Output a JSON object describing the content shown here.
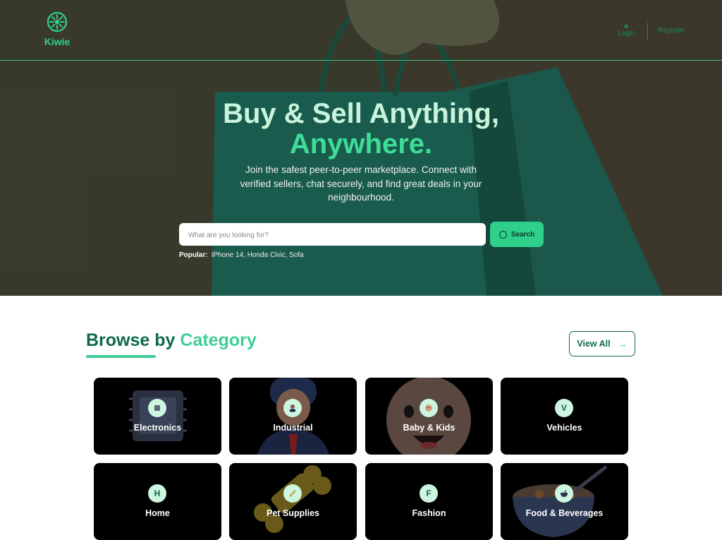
{
  "brand": {
    "name": "Kiwie",
    "color": "#2fd08a"
  },
  "nav": {
    "login_label": "Login",
    "register_label": "Register"
  },
  "hero": {
    "title_line1": "Buy & Sell Anything,",
    "title_line2": "Anywhere.",
    "subtitle": "Join the safest peer-to-peer marketplace. Connect with verified sellers, chat securely, and find great deals in your neighbourhood.",
    "search_placeholder": "What are you looking for?",
    "search_button": "Search",
    "popular_label": "Popular:",
    "popular_items": "IPhone 14, Honda Civic, Sofa"
  },
  "categories": {
    "title_part1": "Browse by",
    "title_part2": "Category",
    "view_all": "View All",
    "items": [
      {
        "label": "Electronics",
        "icon": "chip-icon"
      },
      {
        "label": "Industrial",
        "icon": "worker-icon"
      },
      {
        "label": "Baby & Kids",
        "icon": "baby-icon"
      },
      {
        "label": "Vehicles",
        "letter": "V"
      },
      {
        "label": "Home",
        "letter": "H"
      },
      {
        "label": "Pet Supplies",
        "icon": "bone-icon"
      },
      {
        "label": "Fashion",
        "letter": "F"
      },
      {
        "label": "Food & Beverages",
        "icon": "bowl-icon"
      }
    ]
  },
  "colors": {
    "accent": "#2fd08a",
    "dark_green": "#0e6a48",
    "light_green": "#3fcf94"
  }
}
